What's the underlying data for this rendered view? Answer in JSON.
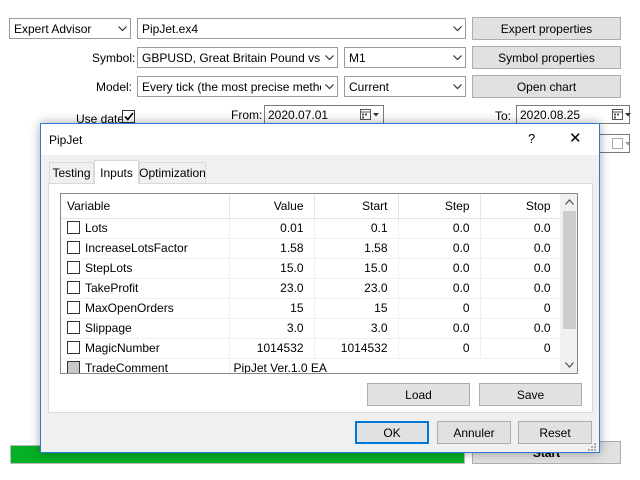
{
  "main": {
    "mode_select": "Expert Advisor",
    "expert_select": "PipJet.ex4",
    "expert_properties_label": "Expert properties",
    "symbol_label": "Symbol:",
    "symbol_select": "GBPUSD, Great Britain Pound vs US",
    "period_select": "M1",
    "symbol_properties_label": "Symbol properties",
    "model_label": "Model:",
    "model_select": "Every tick (the most precise method b",
    "spread_select": "Current",
    "open_chart_label": "Open chart",
    "use_date_label": "Use date",
    "use_date_checked": true,
    "from_label": "From:",
    "from_date": "2020.07.01",
    "to_label": "To:",
    "to_date": "2020.08.25",
    "start_label": "Start",
    "progress_fraction": 1.0
  },
  "dialog": {
    "title": "PipJet",
    "help_label": "?",
    "close_label": "✕",
    "tabs": [
      {
        "label": "Testing",
        "active": false
      },
      {
        "label": "Inputs",
        "active": true
      },
      {
        "label": "Optimization",
        "active": false
      }
    ],
    "columns": [
      "Variable",
      "Value",
      "Start",
      "Step",
      "Stop"
    ],
    "rows": [
      {
        "name": "Lots",
        "value": "0.01",
        "start": "0.1",
        "step": "0.0",
        "stop": "0.0"
      },
      {
        "name": "IncreaseLotsFactor",
        "value": "1.58",
        "start": "1.58",
        "step": "0.0",
        "stop": "0.0"
      },
      {
        "name": "StepLots",
        "value": "15.0",
        "start": "15.0",
        "step": "0.0",
        "stop": "0.0"
      },
      {
        "name": "TakeProfit",
        "value": "23.0",
        "start": "23.0",
        "step": "0.0",
        "stop": "0.0"
      },
      {
        "name": "MaxOpenOrders",
        "value": "15",
        "start": "15",
        "step": "0",
        "stop": "0"
      },
      {
        "name": "Slippage",
        "value": "3.0",
        "start": "3.0",
        "step": "0.0",
        "stop": "0.0"
      },
      {
        "name": "MagicNumber",
        "value": "1014532",
        "start": "1014532",
        "step": "0",
        "stop": "0"
      },
      {
        "name": "TradeComment",
        "value": "PipJet Ver.1.0 EA",
        "start": "",
        "step": "",
        "stop": ""
      }
    ],
    "load_label": "Load",
    "save_label": "Save",
    "ok_label": "OK",
    "cancel_label": "Annuler",
    "reset_label": "Reset"
  }
}
